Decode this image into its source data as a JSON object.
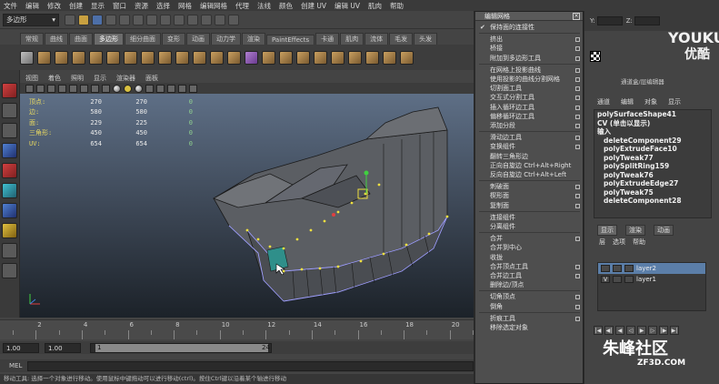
{
  "menubar": [
    "文件",
    "编辑",
    "修改",
    "创建",
    "显示",
    "窗口",
    "资源",
    "选择",
    "网格",
    "编辑网格",
    "代理",
    "法线",
    "颜色",
    "创建 UV",
    "编辑 UV",
    "肌肉",
    "帮助"
  ],
  "statusline": {
    "mode": "多边形"
  },
  "shelf_tabs": [
    "常规",
    "曲线",
    "曲面",
    "多边形",
    "细分曲面",
    "变形",
    "动画",
    "动力学",
    "渲染",
    "PaintEffects",
    "卡通",
    "肌肉",
    "流体",
    "毛发",
    "头发"
  ],
  "shelf_active_tab": 3,
  "viewport_menu": [
    "视图",
    "着色",
    "照明",
    "显示",
    "渲染器",
    "面板"
  ],
  "hud": [
    {
      "label": "顶点:",
      "a": "270",
      "b": "270",
      "c": "0"
    },
    {
      "label": "边:",
      "a": "580",
      "b": "580",
      "c": "0"
    },
    {
      "label": "面:",
      "a": "229",
      "b": "225",
      "c": "0"
    },
    {
      "label": "三角形:",
      "a": "450",
      "b": "450",
      "c": "0"
    },
    {
      "label": "UV:",
      "a": "654",
      "b": "654",
      "c": "0"
    }
  ],
  "timeline_ticks": [
    "2",
    "4",
    "6",
    "8",
    "10",
    "12",
    "14",
    "16",
    "18",
    "20"
  ],
  "range": {
    "start": "1.00",
    "start2": "1.00",
    "slider_start": "1",
    "slider_end": "24"
  },
  "mel_label": "MEL",
  "help_text": "移动工具: 选择一个对象进行移动。使用鼠标中键拖动可以进行移动(ctrl)。按住Ctrl键以沿着某个轴进行移动",
  "popup": {
    "title": "编辑网格",
    "items": [
      {
        "label": "保持面的连接性",
        "check": true,
        "box": false
      },
      {
        "sep": true
      },
      {
        "label": "挤出",
        "box": true
      },
      {
        "label": "桥接",
        "box": true
      },
      {
        "label": "附加到多边形工具",
        "box": true
      },
      {
        "sep": true
      },
      {
        "label": "在网格上投影曲线",
        "box": true
      },
      {
        "label": "使用投影的曲线分割网格",
        "box": true
      },
      {
        "label": "切割面工具",
        "box": true
      },
      {
        "label": "交互式分割工具",
        "box": true
      },
      {
        "label": "插入循环边工具",
        "box": true
      },
      {
        "label": "偏移循环边工具",
        "box": true
      },
      {
        "label": "添加分段",
        "box": true
      },
      {
        "sep": true
      },
      {
        "label": "滑动边工具",
        "box": true
      },
      {
        "label": "变换组件",
        "box": true
      },
      {
        "label": "翻转三角形边",
        "box": false
      },
      {
        "label": "正向自旋边  Ctrl+Alt+Right",
        "box": false
      },
      {
        "label": "反向自旋边  Ctrl+Alt+Left",
        "box": false
      },
      {
        "sep": true
      },
      {
        "label": "刺破面",
        "box": true
      },
      {
        "label": "楔形面",
        "box": true
      },
      {
        "label": "复制面",
        "box": true
      },
      {
        "sep": true
      },
      {
        "label": "连接组件",
        "box": false
      },
      {
        "label": "分离组件",
        "box": false
      },
      {
        "sep": true
      },
      {
        "label": "合并",
        "box": true
      },
      {
        "label": "合并到中心",
        "box": false
      },
      {
        "label": "收拢",
        "box": false
      },
      {
        "label": "合并顶点工具",
        "box": true
      },
      {
        "label": "合并边工具",
        "box": true
      },
      {
        "label": "删除边/顶点",
        "box": false
      },
      {
        "sep": true
      },
      {
        "label": "切角顶点",
        "box": true
      },
      {
        "label": "倒角",
        "box": true
      },
      {
        "sep": true
      },
      {
        "label": "折痕工具",
        "box": true
      },
      {
        "label": "移除选定对象",
        "box": false
      }
    ]
  },
  "rightpanel": {
    "fields": [
      "Y:",
      "Z:"
    ],
    "watermark1": "YOUKU",
    "watermark2": "优酷",
    "channel_title": "通道盒/层编辑器",
    "channel_tabs": [
      "通道",
      "编辑",
      "对象",
      "显示"
    ],
    "history": [
      {
        "t": "polySurfaceShape41",
        "sub": false
      },
      {
        "t": "CV (单击以显示)",
        "sub": false
      },
      {
        "t": "输入",
        "sub": false
      },
      {
        "t": "deleteComponent29",
        "sub": true
      },
      {
        "t": "polyExtrudeFace10",
        "sub": true
      },
      {
        "t": "polyTweak77",
        "sub": true
      },
      {
        "t": "polySplitRing159",
        "sub": true
      },
      {
        "t": "polyTweak76",
        "sub": true
      },
      {
        "t": "polyExtrudeEdge27",
        "sub": true
      },
      {
        "t": "polyTweak75",
        "sub": true
      },
      {
        "t": "deleteComponent28",
        "sub": true
      }
    ],
    "layer_tabs": [
      "显示",
      "渲染",
      "动画"
    ],
    "layer_menu": [
      "层",
      "选项",
      "帮助"
    ],
    "layers": [
      {
        "v": "",
        "name": "layer2",
        "selected": true
      },
      {
        "v": "V",
        "name": "layer1",
        "selected": false
      }
    ],
    "logo": "朱峰社区",
    "logo_sub": "ZF3D.COM"
  }
}
